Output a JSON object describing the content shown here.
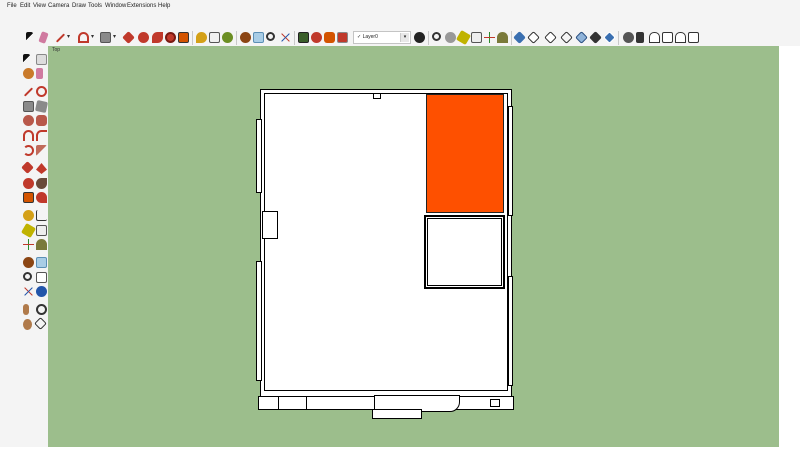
{
  "menu": [
    "File",
    "Edit",
    "View",
    "Camera",
    "Draw",
    "Tools",
    "Window",
    "Extensions",
    "Help"
  ],
  "toolbar": {
    "layer": {
      "check": "✓",
      "value": "Layer0"
    }
  },
  "viewport": {
    "view_label": "Top",
    "background_color": "#9cbe8c",
    "highlighted_room_color": "#fe5000"
  },
  "icons": {
    "select": "select-arrow-icon",
    "eraser": "eraser-icon",
    "pencil": "pencil-line-icon",
    "arc": "arc-icon",
    "rectangle": "rectangle-icon",
    "push_pull": "push-pull-icon",
    "move": "move-icon",
    "rotate": "rotate-icon",
    "scale": "scale-icon",
    "offset": "offset-icon",
    "tape": "tape-measure-icon",
    "dimension": "dimension-icon",
    "protractor": "protractor-icon",
    "text": "text-icon",
    "axes": "axes-icon",
    "orbit": "orbit-icon",
    "pan": "pan-icon",
    "zoom": "zoom-icon",
    "zoom_window": "zoom-window-icon",
    "zoom_extents": "zoom-extents-icon",
    "walk": "walk-icon",
    "look_around": "look-around-icon",
    "section_plane": "section-plane-icon",
    "iso_view": "iso-view-icon",
    "top_view": "top-view-icon",
    "front_view": "front-view-icon",
    "right_view": "right-view-icon",
    "back_view": "back-view-icon",
    "left_view": "left-view-icon"
  }
}
